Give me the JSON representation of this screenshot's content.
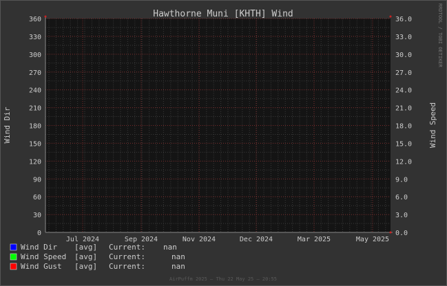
{
  "chart_data": {
    "type": "line",
    "title": "Hawthorne Muni [KHTH] Wind",
    "ylabel_left": "Wind Dir",
    "ylabel_right": "Wind Speed",
    "watermark": "RRDTOOL / TOBI OETIKER",
    "footer": "AirPuffm 2025 — Thu 22 May 25 — 20:55",
    "y_left": {
      "min": 0,
      "max": 360,
      "ticks": [
        "0",
        "30",
        "60",
        "90",
        "120",
        "150",
        "180",
        "210",
        "240",
        "270",
        "300",
        "330",
        "360"
      ]
    },
    "y_right": {
      "min": 0,
      "max": 36,
      "ticks": [
        "0.0",
        "3.0",
        "6.0",
        "9.0",
        "12.0",
        "15.0",
        "18.0",
        "21.0",
        "24.0",
        "27.0",
        "30.0",
        "33.0",
        "36.0"
      ]
    },
    "x_ticks": [
      "Jul 2024",
      "Sep 2024",
      "Nov 2024",
      "Dec 2024",
      "Mar 2025",
      "May 2025"
    ],
    "grid": true,
    "series": [
      {
        "name": "Wind Dir",
        "stat": "[avg]",
        "current_label": "Current:",
        "current": "nan",
        "color": "#0000ff",
        "values": []
      },
      {
        "name": "Wind Speed",
        "stat": "[avg]",
        "current_label": "Current:",
        "current": "nan",
        "color": "#00ff00",
        "values": []
      },
      {
        "name": "Wind Gust",
        "stat": "[avg]",
        "current_label": "Current:",
        "current": "nan",
        "color": "#ff0000",
        "values": []
      }
    ]
  },
  "colors": {
    "background": "#323232",
    "plot_area": "#141414",
    "minor_grid": "#3a3a3a",
    "major_grid": "#7a2a2a",
    "text": "#cccccc",
    "axis": "#888888"
  }
}
